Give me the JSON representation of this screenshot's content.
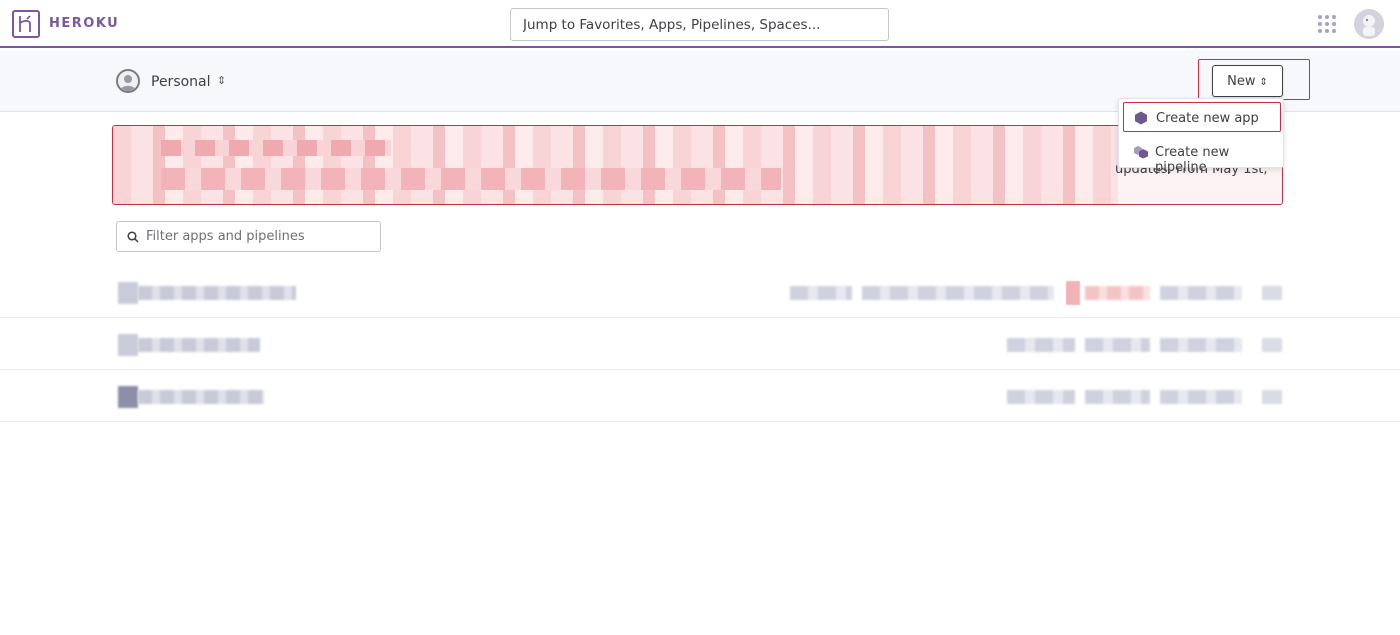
{
  "header": {
    "brand": "HEROKU",
    "search_placeholder": "Jump to Favorites, Apps, Pipelines, Spaces...",
    "accent": "#79589f"
  },
  "subheader": {
    "account_label": "Personal",
    "new_button_label": "New"
  },
  "new_menu": {
    "items": [
      {
        "label": "Create new app",
        "icon": "app-hexagon-icon"
      },
      {
        "label": "Create new pipeline",
        "icon": "pipeline-icon"
      }
    ]
  },
  "banner": {
    "visible_text": "updates. From May 1st,",
    "color": "#c4323f"
  },
  "filter": {
    "placeholder": "Filter apps and pipelines"
  }
}
